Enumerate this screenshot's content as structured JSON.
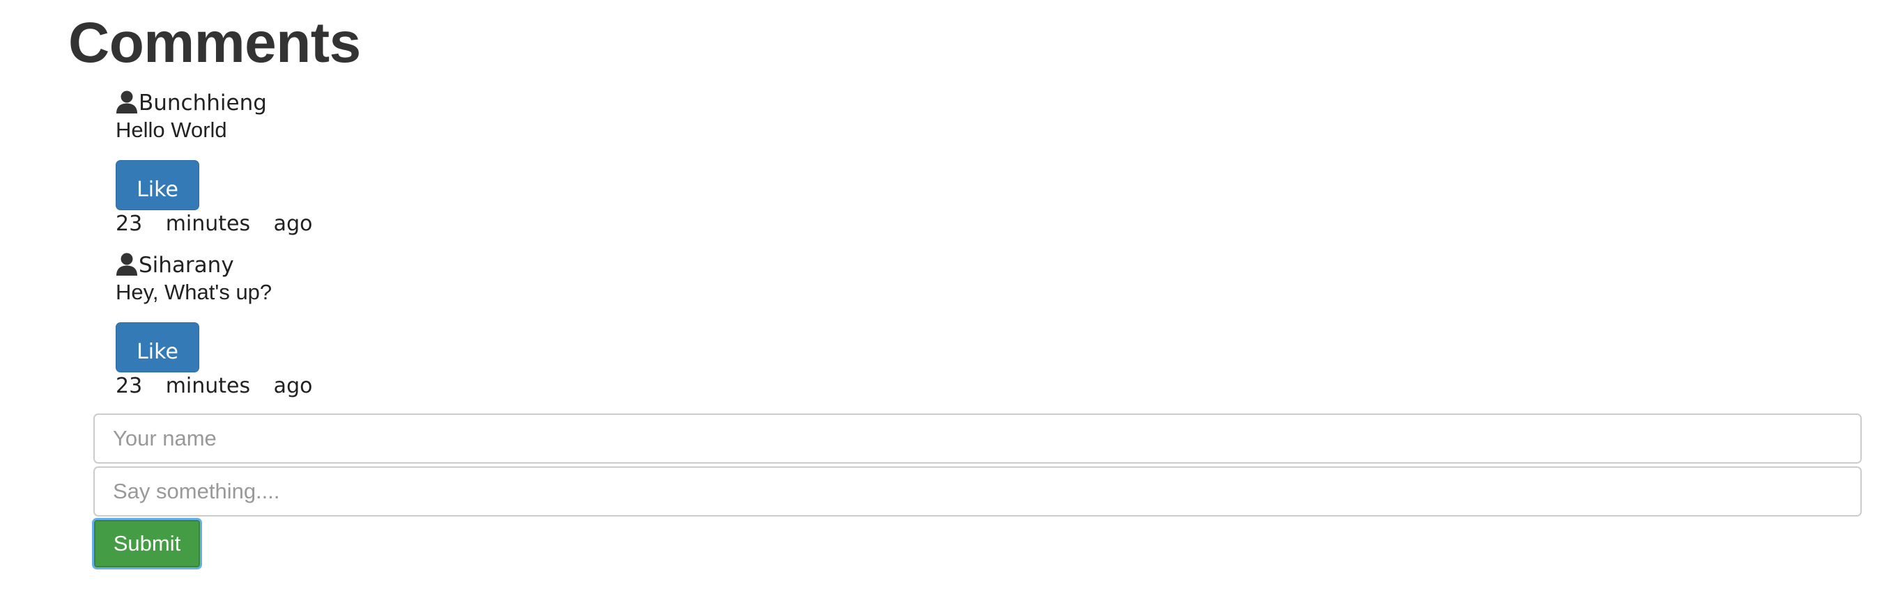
{
  "page": {
    "title": "Comments"
  },
  "comments": [
    {
      "author": "Bunchhieng",
      "text": "Hello World",
      "like_label": "Like",
      "time": "23 minutes ago"
    },
    {
      "author": "Siharany",
      "text": "Hey, What's up?",
      "like_label": "Like",
      "time": "23 minutes ago"
    }
  ],
  "form": {
    "name_placeholder": "Your name",
    "name_value": "",
    "message_placeholder": "Say something....",
    "message_value": "",
    "submit_label": "Submit"
  },
  "icons": {
    "author_icon": "user-icon"
  },
  "colors": {
    "like_button": "#337ab7",
    "submit_button": "#449d44",
    "focus_ring": "#66afe9",
    "text": "#333333"
  }
}
